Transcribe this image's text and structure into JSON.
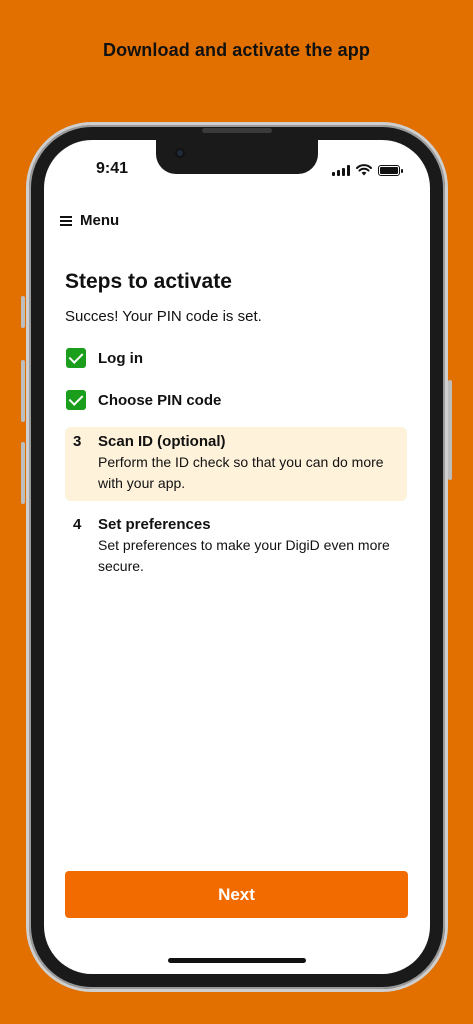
{
  "promo": {
    "title": "Download and activate the app"
  },
  "status_bar": {
    "time": "9:41",
    "icons": [
      "signal-icon",
      "wifi-icon",
      "battery-icon"
    ]
  },
  "menu": {
    "icon": "hamburger-icon",
    "label": "Menu"
  },
  "page": {
    "title": "Steps to activate",
    "message": "Succes! Your PIN code is set."
  },
  "steps": [
    {
      "title": "Log in",
      "status": "done",
      "icon": "checkmark-icon"
    },
    {
      "title": "Choose PIN code",
      "status": "done",
      "icon": "checkmark-icon"
    },
    {
      "number": "3",
      "title": "Scan ID (optional)",
      "description": "Perform the ID check so that you can do more with your app.",
      "status": "active"
    },
    {
      "number": "4",
      "title": "Set preferences",
      "description": "Set preferences to make your DigiD even more secure.",
      "status": "pending"
    }
  ],
  "next_button": {
    "label": "Next"
  },
  "colors": {
    "background": "#E17000",
    "primary_button": "#F26B00",
    "check_green": "#1B9E1B",
    "active_step_bg": "#FFF2DB"
  }
}
